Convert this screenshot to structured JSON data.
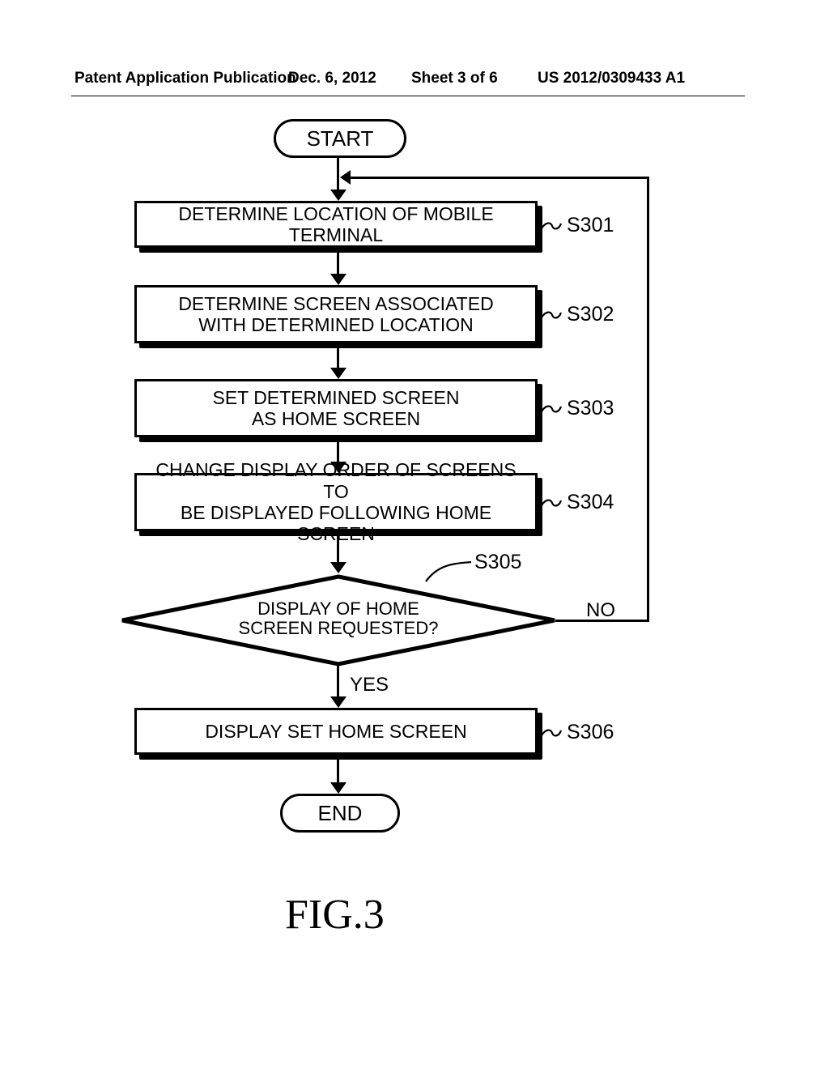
{
  "header": {
    "pub_type": "Patent Application Publication",
    "pub_date": "Dec. 6, 2012",
    "sheet": "Sheet 3 of 6",
    "pub_num": "US 2012/0309433 A1"
  },
  "flow": {
    "start": "START",
    "end": "END",
    "steps": {
      "s301": {
        "text": "DETERMINE LOCATION OF MOBILE TERMINAL",
        "label": "S301"
      },
      "s302": {
        "text_l1": "DETERMINE SCREEN ASSOCIATED",
        "text_l2": "WITH DETERMINED LOCATION",
        "label": "S302"
      },
      "s303": {
        "text_l1": "SET DETERMINED SCREEN",
        "text_l2": "AS HOME SCREEN",
        "label": "S303"
      },
      "s304": {
        "text_l1": "CHANGE DISPLAY ORDER OF SCREENS TO",
        "text_l2": "BE DISPLAYED FOLLOWING HOME SCREEN",
        "label": "S304"
      },
      "s305": {
        "text_l1": "DISPLAY OF HOME",
        "text_l2": "SCREEN REQUESTED?",
        "label": "S305"
      },
      "s306": {
        "text": "DISPLAY SET HOME SCREEN",
        "label": "S306"
      }
    },
    "branches": {
      "yes": "YES",
      "no": "NO"
    }
  },
  "figure_label": "FIG.3",
  "chart_data": {
    "type": "flowchart",
    "title": "FIG.3",
    "nodes": [
      {
        "id": "start",
        "kind": "terminator",
        "text": "START"
      },
      {
        "id": "S301",
        "kind": "process",
        "text": "DETERMINE LOCATION OF MOBILE TERMINAL"
      },
      {
        "id": "S302",
        "kind": "process",
        "text": "DETERMINE SCREEN ASSOCIATED WITH DETERMINED LOCATION"
      },
      {
        "id": "S303",
        "kind": "process",
        "text": "SET DETERMINED SCREEN AS HOME SCREEN"
      },
      {
        "id": "S304",
        "kind": "process",
        "text": "CHANGE DISPLAY ORDER OF SCREENS TO BE DISPLAYED FOLLOWING HOME SCREEN"
      },
      {
        "id": "S305",
        "kind": "decision",
        "text": "DISPLAY OF HOME SCREEN REQUESTED?"
      },
      {
        "id": "S306",
        "kind": "process",
        "text": "DISPLAY SET HOME SCREEN"
      },
      {
        "id": "end",
        "kind": "terminator",
        "text": "END"
      }
    ],
    "edges": [
      {
        "from": "start",
        "to": "S301"
      },
      {
        "from": "S301",
        "to": "S302"
      },
      {
        "from": "S302",
        "to": "S303"
      },
      {
        "from": "S303",
        "to": "S304"
      },
      {
        "from": "S304",
        "to": "S305"
      },
      {
        "from": "S305",
        "to": "S306",
        "label": "YES"
      },
      {
        "from": "S305",
        "to": "S301",
        "label": "NO"
      },
      {
        "from": "S306",
        "to": "end"
      }
    ]
  }
}
